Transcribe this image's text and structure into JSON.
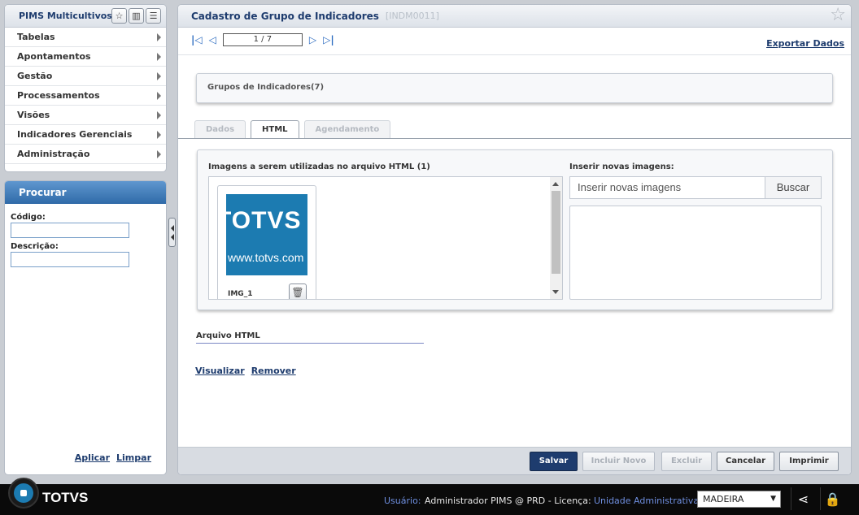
{
  "left_menu": {
    "title": "PIMS Multicultivos",
    "items": [
      {
        "label": "Tabelas"
      },
      {
        "label": "Apontamentos"
      },
      {
        "label": "Gestão"
      },
      {
        "label": "Processamentos"
      },
      {
        "label": "Visões"
      },
      {
        "label": "Indicadores Gerenciais"
      },
      {
        "label": "Administração"
      }
    ]
  },
  "search": {
    "title": "Procurar",
    "codigo_label": "Código:",
    "descricao_label": "Descrição:",
    "apply": "Aplicar",
    "clear": "Limpar"
  },
  "main": {
    "title": "Cadastro de Grupo de Indicadores",
    "code": "[INDM0011]",
    "record_position": "1 / 7",
    "export": "Exportar Dados",
    "group_title": "Grupos de Indicadores(7)",
    "tabs": [
      {
        "label": "Dados"
      },
      {
        "label": "HTML"
      },
      {
        "label": "Agendamento"
      }
    ],
    "images_label": "Imagens a serem utilizadas no arquivo HTML (1)",
    "image_card": {
      "name": "IMG_1",
      "logo_text": "TOTVS",
      "logo_url": "www.totvs.com"
    },
    "insert_label": "Inserir novas imagens:",
    "insert_placeholder": "Inserir novas imagens",
    "search_button": "Buscar",
    "arquivo_label": "Arquivo HTML",
    "view_link": "Visualizar",
    "remove_link": "Remover",
    "buttons": {
      "save": "Salvar",
      "new": "Incluir Novo",
      "delete": "Excluir",
      "cancel": "Cancelar",
      "print": "Imprimir"
    }
  },
  "status_bar": {
    "brand": "TOTVS",
    "user_label": "Usuário:",
    "user_value": "Administrador PIMS @ PRD - Licença:",
    "unit_label": "Unidade Administrativa:",
    "unit_value": "MADEIRA"
  },
  "colors": {
    "accent": "#1e3c6e",
    "brand_blue": "#1c7bb1"
  }
}
